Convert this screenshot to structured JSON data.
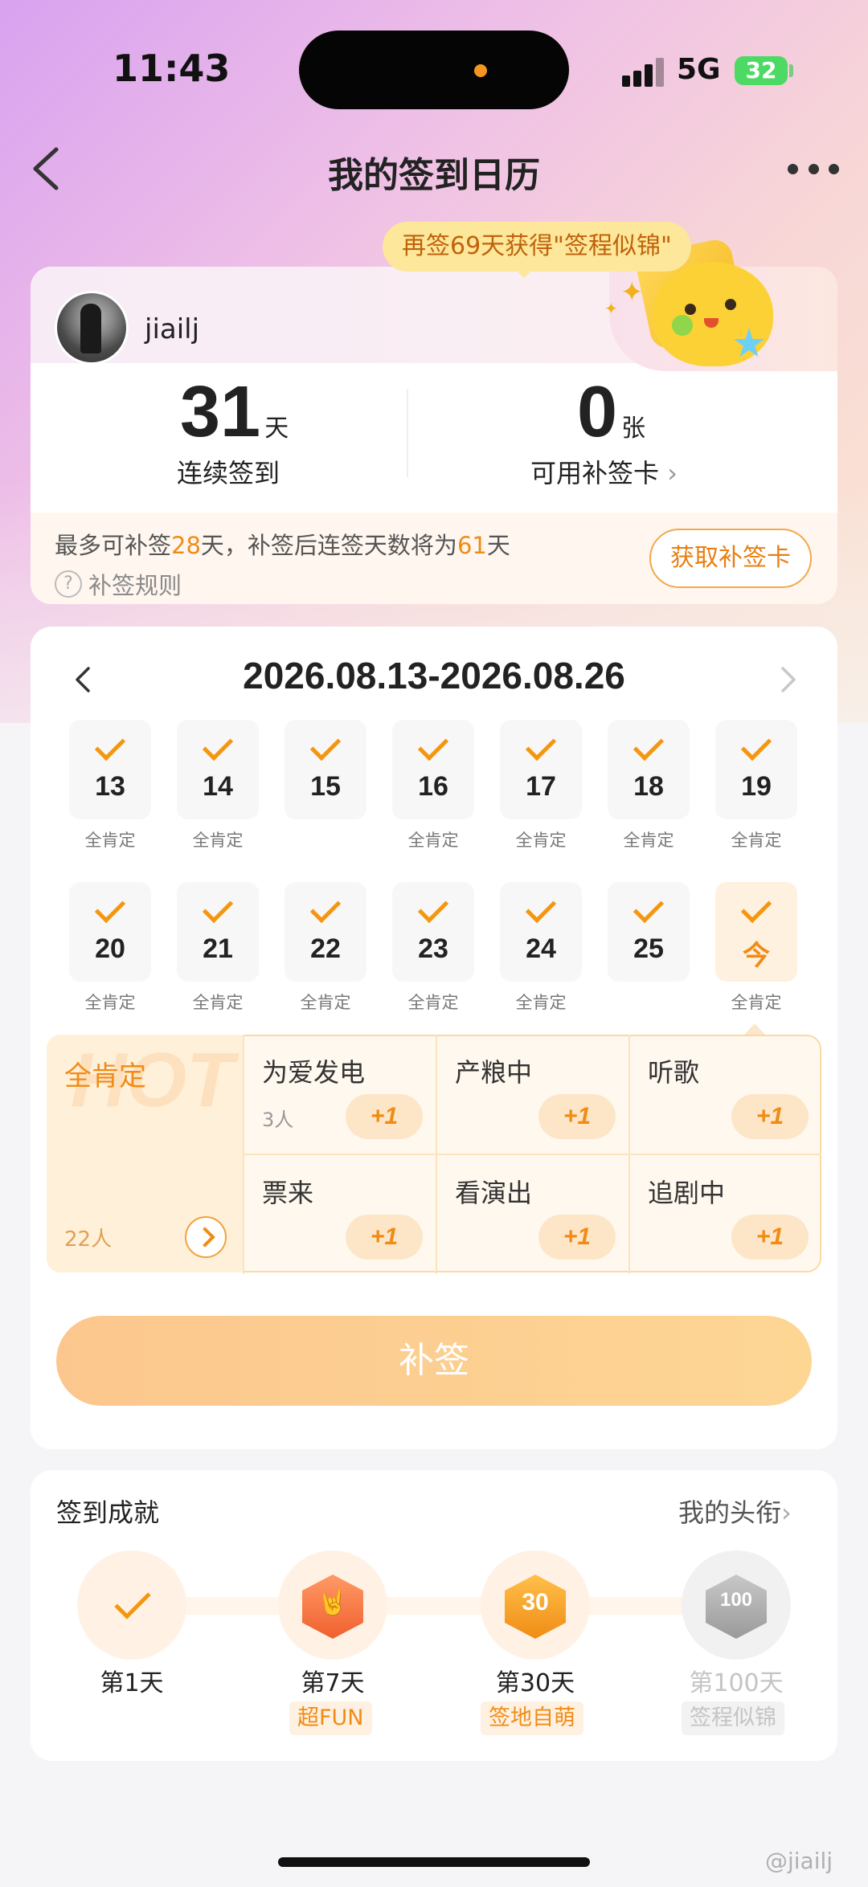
{
  "status_bar": {
    "time": "11:43",
    "network": "5G",
    "battery": "32"
  },
  "nav": {
    "title": "我的签到日历"
  },
  "promo": {
    "text": "再签69天获得\"签程似锦\""
  },
  "profile": {
    "username": "jiailj"
  },
  "stats": {
    "streak_value": "31",
    "streak_unit": "天",
    "streak_label": "连续签到",
    "cards_value": "0",
    "cards_unit": "张",
    "cards_label": "可用补签卡",
    "cards_chevron": "›"
  },
  "makeup": {
    "pre1": "最多可补签",
    "days_max": "28",
    "pre2": "天，补签后连签天数将为",
    "days_after": "61",
    "post": "天",
    "rule_label": "补签规则",
    "rule_icon": "?",
    "get_card_label": "获取补签卡"
  },
  "calendar": {
    "range": "2026.08.13-2026.08.26",
    "days": [
      {
        "num": "13",
        "tag": "全肯定"
      },
      {
        "num": "14",
        "tag": "全肯定"
      },
      {
        "num": "15",
        "tag": ""
      },
      {
        "num": "16",
        "tag": "全肯定"
      },
      {
        "num": "17",
        "tag": "全肯定"
      },
      {
        "num": "18",
        "tag": "全肯定"
      },
      {
        "num": "19",
        "tag": "全肯定"
      },
      {
        "num": "20",
        "tag": "全肯定"
      },
      {
        "num": "21",
        "tag": "全肯定"
      },
      {
        "num": "22",
        "tag": "全肯定"
      },
      {
        "num": "23",
        "tag": "全肯定"
      },
      {
        "num": "24",
        "tag": "全肯定"
      },
      {
        "num": "25",
        "tag": ""
      },
      {
        "num": "今",
        "tag": "全肯定"
      }
    ]
  },
  "moods": {
    "featured": {
      "label": "全肯定",
      "count": "22人",
      "watermark": "HOT"
    },
    "items": [
      {
        "label": "为爱发电",
        "count": "3人",
        "plus": "+1"
      },
      {
        "label": "产粮中",
        "count": "",
        "plus": "+1"
      },
      {
        "label": "听歌",
        "count": "",
        "plus": "+1"
      },
      {
        "label": "票来",
        "count": "",
        "plus": "+1"
      },
      {
        "label": "看演出",
        "count": "",
        "plus": "+1"
      },
      {
        "label": "追剧中",
        "count": "",
        "plus": "+1"
      }
    ]
  },
  "supplement_button": "补签",
  "achievements": {
    "title": "签到成就",
    "link": "我的头衔",
    "link_chevron": "›",
    "items": [
      {
        "day": "第1天",
        "badge": ""
      },
      {
        "day": "第7天",
        "badge": "超FUN",
        "hex_text": "🤘"
      },
      {
        "day": "第30天",
        "badge": "签地自萌",
        "hex_text": "30"
      },
      {
        "day": "第100天",
        "badge": "签程似锦",
        "hex_text": "100"
      }
    ]
  },
  "watermark": "@jiailj",
  "colors": {
    "accent": "#f08c15",
    "button": "#fcc78e"
  }
}
